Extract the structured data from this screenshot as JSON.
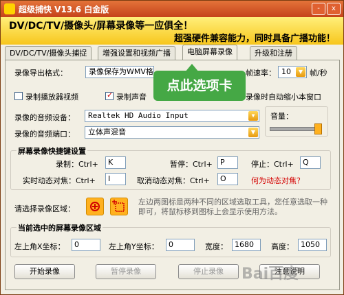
{
  "window": {
    "title": "超级捕快 V13.6 白金版",
    "minimize_label": "-",
    "close_label": "x"
  },
  "banner": {
    "line1": "DV/DC/TV/摄像头/屏幕录像等一应俱全！",
    "line2": "超强硬件兼容能力，同时具备广播功能！"
  },
  "tabs": [
    {
      "label": "DV/DC/TV/摄像头捕捉",
      "active": false
    },
    {
      "label": "增强设置和视频广播",
      "active": false
    },
    {
      "label": "电脑屏幕录像",
      "active": true
    },
    {
      "label": "升级和注册",
      "active": false
    }
  ],
  "tooltip": {
    "text": "点此选项卡",
    "color": "#45a845"
  },
  "export": {
    "label": "录像导出格式：",
    "value": "录像保存为WMV格式",
    "frame_rate_label": "帧速率：",
    "frame_rate_value": "10",
    "frame_rate_unit": "帧/秒"
  },
  "options": {
    "record_player": {
      "label": "录制播放器视频",
      "checked": false
    },
    "record_sound": {
      "label": "录制声音",
      "checked": true
    },
    "minimize_window": {
      "label": "录像时自动缩小本窗口"
    }
  },
  "audio": {
    "device_label": "录像的音频设备：",
    "device_value": "Realtek HD Audio Input",
    "port_label": "录像的音频端口：",
    "port_value": "立体声混音",
    "volume_label": "音量：",
    "volume_level": 0.93
  },
  "hotkeys": {
    "title": "屏幕录像快捷键设置",
    "record_label": "录制：Ctrl+",
    "record_key": "K",
    "pause_label": "暂停：Ctrl+",
    "pause_key": "P",
    "stop_label": "停止：Ctrl+",
    "stop_key": "Q",
    "realtime_label": "实时动态对焦：Ctrl+",
    "realtime_key": "I",
    "cancel_realtime_label": "取消动态对焦：Ctrl+",
    "cancel_realtime_key": "O",
    "help_link": "何为动态对焦？"
  },
  "region": {
    "select_label": "请选择录像区域：",
    "hint": "左边两图标是两种不同的区域选取工具，您任意选取一种即可，将鼠标移到图标上会显示使用方法。",
    "current_title": "当前选中的屏幕录像区域",
    "x_label": "左上角X坐标：",
    "x_value": "0",
    "y_label": "左上角Y坐标：",
    "y_value": "0",
    "width_label": "宽度：",
    "width_value": "1680",
    "height_label": "高度：",
    "height_value": "1050"
  },
  "buttons": {
    "start": "开始录像",
    "pause": "暂停录像",
    "stop": "停止录像",
    "help": "注意说明"
  },
  "watermark": "Bai百度"
}
